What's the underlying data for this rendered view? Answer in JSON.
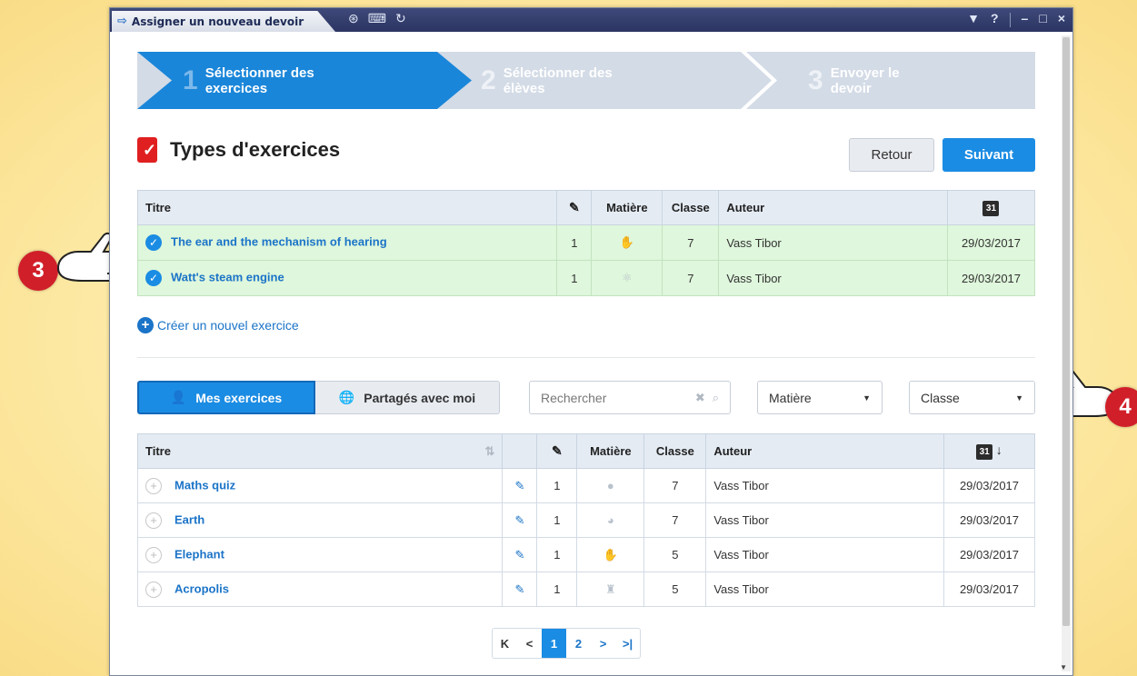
{
  "window": {
    "title": "Assigner un nouveau devoir",
    "controls": [
      "▼",
      "?",
      "–",
      "□",
      "×"
    ]
  },
  "wizard": {
    "steps": [
      {
        "num": "1",
        "line1": "Sélectionner des",
        "line2": "exercices",
        "active": true
      },
      {
        "num": "2",
        "line1": "Sélectionner des",
        "line2": "élèves",
        "active": false
      },
      {
        "num": "3",
        "line1": "Envoyer le",
        "line2": "devoir",
        "active": false
      }
    ]
  },
  "header": {
    "title": "Types d'exercices",
    "back_label": "Retour",
    "next_label": "Suivant"
  },
  "selected_table": {
    "columns": {
      "title": "Titre",
      "subject": "Matière",
      "class": "Classe",
      "author": "Auteur",
      "date_icon": "31"
    },
    "rows": [
      {
        "title": "The ear and the mechanism of hearing",
        "count": "1",
        "class": "7",
        "author": "Vass Tibor",
        "date": "29/03/2017",
        "subject_icon": "hand-icon"
      },
      {
        "title": "Watt's steam engine",
        "count": "1",
        "class": "7",
        "author": "Vass Tibor",
        "date": "29/03/2017",
        "subject_icon": "atom-icon"
      }
    ]
  },
  "create_link": "Créer un nouvel exercice",
  "filters": {
    "tab_mine": "Mes exercices",
    "tab_shared": "Partagés avec moi",
    "search_placeholder": "Rechercher",
    "subject_dropdown": "Matière",
    "class_dropdown": "Classe"
  },
  "exercises_table": {
    "columns": {
      "title": "Titre",
      "subject": "Matière",
      "class": "Classe",
      "author": "Auteur",
      "date_icon": "31"
    },
    "rows": [
      {
        "title": "Maths quiz",
        "count": "1",
        "class": "7",
        "author": "Vass Tibor",
        "date": "29/03/2017",
        "subject_icon": "globe-icon"
      },
      {
        "title": "Earth",
        "count": "1",
        "class": "7",
        "author": "Vass Tibor",
        "date": "29/03/2017",
        "subject_icon": "globe-icon"
      },
      {
        "title": "Elephant",
        "count": "1",
        "class": "5",
        "author": "Vass Tibor",
        "date": "29/03/2017",
        "subject_icon": "hand-icon"
      },
      {
        "title": "Acropolis",
        "count": "1",
        "class": "5",
        "author": "Vass Tibor",
        "date": "29/03/2017",
        "subject_icon": "helmet-icon"
      }
    ]
  },
  "pagination": {
    "first": "K",
    "prev": "<",
    "pages": [
      "1",
      "2"
    ],
    "current": "1",
    "next": ">",
    "last": ">|"
  },
  "callouts": {
    "left_number": "3",
    "right_number": "4"
  },
  "colors": {
    "accent": "#1b8ce3",
    "selected_row": "#dff7dc",
    "badge": "#d11f2a"
  }
}
